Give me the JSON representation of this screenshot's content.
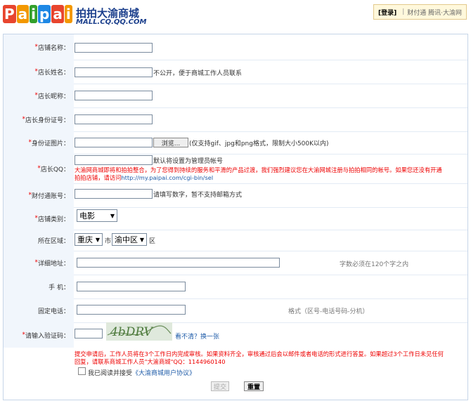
{
  "header": {
    "logo_letters": [
      "P",
      "a",
      "i",
      "p",
      "a",
      "i"
    ],
    "logo_colors": [
      "#e8452e",
      "#f39800",
      "#33a02c",
      "#1e88e5",
      "#e8452e",
      "#f39800"
    ],
    "site_name": "拍拍大渝商城",
    "site_sub": "MALL.CQ.QQ.COM",
    "login": "[登录]",
    "sep": "|",
    "links": "财付通 腾讯·大渝网"
  },
  "form": {
    "shop_name": {
      "label": "店铺名称："
    },
    "owner_name": {
      "label": "店长姓名：",
      "note": "不公开，便于商城工作人员联系"
    },
    "owner_nick": {
      "label": "店长昵称："
    },
    "owner_id": {
      "label": "店长身份证号："
    },
    "id_image": {
      "label": "身份证图片：",
      "button": "浏览...",
      "note": "(仅支持gif、jpg和png格式，限制大小500K以内)"
    },
    "owner_qq": {
      "label": "店长QQ：",
      "note": "默认将设置为管理员帐号",
      "warning_1": "大渝网商城即将和拍拍整合，为了您得到持续的服务和平滑的产品过渡，我们强烈建议您在大渝网城注册与拍拍相同的帐号。如果您还没有开通",
      "warning_2a": "拍拍店铺，请访问",
      "warning_link": "http://my.paipai.com/cgi-bin/sel"
    },
    "tenpay": {
      "label": "财付通账号：",
      "note": "请填写数字，暂不支持邮箱方式"
    },
    "category": {
      "label": "店铺类别：",
      "value": "电影"
    },
    "region": {
      "label": "所在区域：",
      "province": "重庆",
      "city_suffix": "市",
      "district": "渝中区",
      "district_suffix": "区"
    },
    "address": {
      "label": "详细地址：",
      "note": "字数必须在120个字之内"
    },
    "mobile": {
      "label": "手 机："
    },
    "phone": {
      "label": "固定电话：",
      "note": "格式（区号-电话号码-分机）"
    },
    "captcha": {
      "label": "请输入验证码：",
      "image_text": "4bDRV",
      "refresh": "看不清？换一张"
    },
    "submit_note_1": "提交申请后，工作人员将在3个工作日内完成审核。如果资料齐全，审核通过后会以邮件或者电话的形式进行答复。如果超过3个工作日未见任何",
    "submit_note_2": "回复，请联系商城工作人员\"大渝商城\"QQ：1144960140",
    "agree_text": "我已阅读并接受",
    "agree_link": "《大渝商城用户协议》",
    "submit_button": "提交",
    "reset_button": "重置",
    "required_mark": "*"
  },
  "colors": {
    "accent_blue": "#1b3f8c",
    "required_red": "#e00000",
    "label_bg": "#f1f6fc"
  }
}
